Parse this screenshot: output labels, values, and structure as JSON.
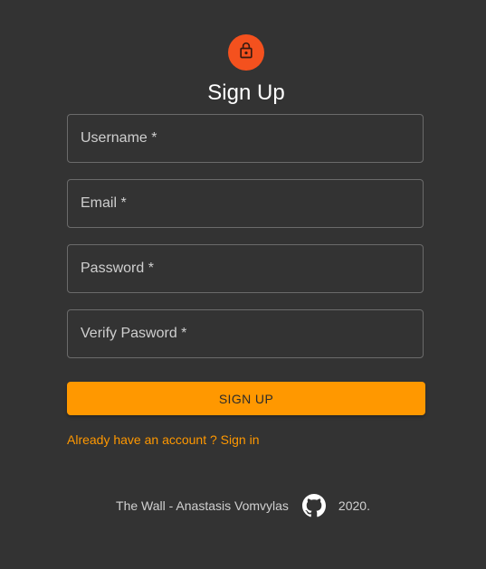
{
  "header": {
    "icon": "lock-icon",
    "accent_color": "#f4511e",
    "title": "Sign Up"
  },
  "form": {
    "username_placeholder": "Username *",
    "email_placeholder": "Email *",
    "password_placeholder": "Password *",
    "verify_password_placeholder": "Verify Pasword *",
    "submit_label": "SIGN UP",
    "submit_color": "#ff9800"
  },
  "signin_link": {
    "label": "Already have an account ? Sign in"
  },
  "footer": {
    "credit": "The Wall - Anastasis Vomvylas",
    "icon": "github-icon",
    "year": "2020."
  }
}
